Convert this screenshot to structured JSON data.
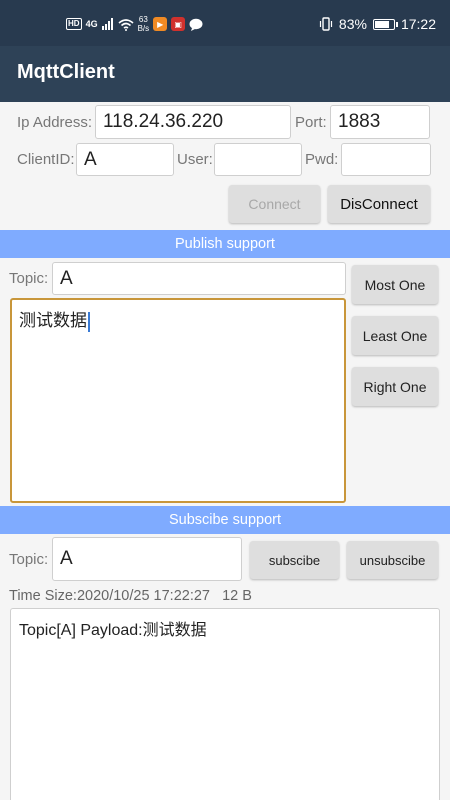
{
  "statusbar": {
    "hd": "HD",
    "network": "4G",
    "net_speed_value": "63",
    "net_speed_unit": "B/s",
    "battery": "83%",
    "battery_level": 0.83,
    "time": "17:22"
  },
  "appbar": {
    "title": "MqttClient"
  },
  "connection": {
    "ip_label": "Ip Address:",
    "ip_value": "118.24.36.220",
    "port_label": "Port:",
    "port_value": "1883",
    "client_label": "ClientID:",
    "client_value": "A",
    "user_label": "User:",
    "user_value": "",
    "pwd_label": "Pwd:",
    "pwd_value": "",
    "connect_label": "Connect",
    "disconnect_label": "DisConnect"
  },
  "publish": {
    "section_title": "Publish support",
    "topic_label": "Topic:",
    "topic_value": "A",
    "payload_text": "测试数据",
    "qos_buttons": [
      "Most One",
      "Least One",
      "Right One"
    ]
  },
  "subscribe": {
    "section_title": "Subscibe support",
    "topic_label": "Topic:",
    "topic_value": "A",
    "subscribe_label": "subscibe",
    "unsubscribe_label": "unsubscibe",
    "time_size_text": "Time Size:2020/10/25 17:22:27   12 B",
    "log_text": "Topic[A] Payload:测试数据"
  },
  "colors": {
    "statusbar": "#283a4f",
    "appbar": "#2e4257",
    "section_bar": "#7fabff",
    "focus_border": "#c8963a"
  }
}
